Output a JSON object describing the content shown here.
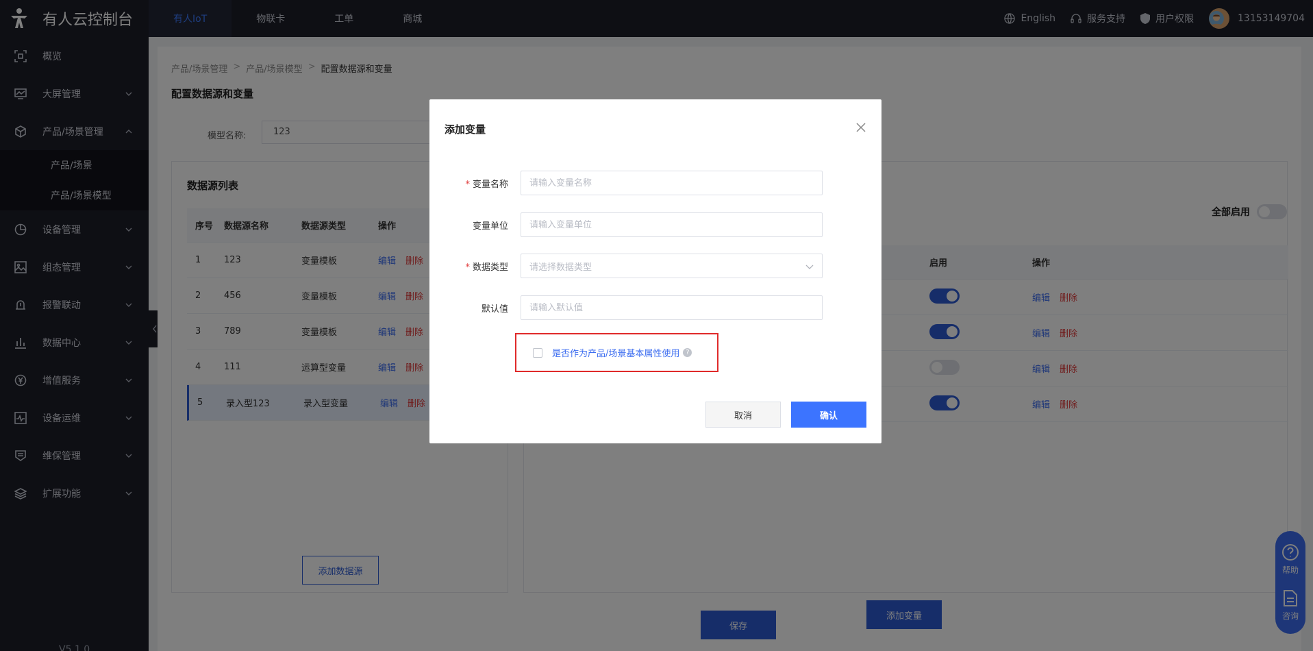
{
  "app": {
    "title": "有人云控制台",
    "version": "V5.1.0"
  },
  "topnav": {
    "tabs": [
      {
        "label": "有人IoT",
        "active": true
      },
      {
        "label": "物联卡",
        "active": false
      },
      {
        "label": "工单",
        "active": false
      },
      {
        "label": "商城",
        "active": false
      }
    ],
    "language": "English",
    "support": "服务支持",
    "permissions": "用户权限",
    "username": "13153149704"
  },
  "sidebar": {
    "items": [
      {
        "label": "概览",
        "icon": "overview-icon"
      },
      {
        "label": "大屏管理",
        "icon": "screen-icon"
      },
      {
        "label": "产品/场景管理",
        "icon": "cube-icon",
        "expanded": true
      },
      {
        "label": "设备管理",
        "icon": "pie-icon"
      },
      {
        "label": "组态管理",
        "icon": "image-icon"
      },
      {
        "label": "报警联动",
        "icon": "alarm-icon"
      },
      {
        "label": "数据中心",
        "icon": "bar-chart-icon"
      },
      {
        "label": "增值服务",
        "icon": "yen-icon"
      },
      {
        "label": "设备运维",
        "icon": "monitor-icon"
      },
      {
        "label": "维保管理",
        "icon": "shield-icon"
      },
      {
        "label": "扩展功能",
        "icon": "layers-icon"
      }
    ],
    "subitems": [
      "产品/场景",
      "产品/场景模型"
    ]
  },
  "main": {
    "breadcrumb": [
      "产品/场景管理",
      "产品/场景模型",
      "配置数据源和变量"
    ],
    "page_title": "配置数据源和变量",
    "model_name_label": "模型名称:",
    "model_name_value": "123",
    "datasource": {
      "title": "数据源列表",
      "headers": [
        "序号",
        "数据源名称",
        "数据源类型",
        "操作"
      ],
      "rows": [
        {
          "no": "1",
          "name": "123",
          "type": "变量模板"
        },
        {
          "no": "2",
          "name": "456",
          "type": "变量模板"
        },
        {
          "no": "3",
          "name": "789",
          "type": "变量模板"
        },
        {
          "no": "4",
          "name": "111",
          "type": "运算型变量"
        },
        {
          "no": "5",
          "name": "录入型123",
          "type": "录入型变量",
          "selected": true
        }
      ],
      "edit_label": "编辑",
      "delete_label": "删除",
      "add_label": "添加数据源"
    },
    "variables": {
      "all_enable_label": "全部启用",
      "headers": [
        "启用",
        "操作"
      ],
      "rows": [
        {
          "enabled": true
        },
        {
          "enabled": true
        },
        {
          "enabled": false
        },
        {
          "enabled": true
        }
      ],
      "edit_label": "编辑",
      "delete_label": "删除",
      "add_label": "添加变量"
    },
    "save_label": "保存"
  },
  "float_help": {
    "help": "帮助",
    "consult": "咨询"
  },
  "modal": {
    "title": "添加变量",
    "fields": {
      "name": {
        "label": "变量名称",
        "placeholder": "请输入变量名称",
        "required": true
      },
      "unit": {
        "label": "变量单位",
        "placeholder": "请输入变量单位",
        "required": false
      },
      "type": {
        "label": "数据类型",
        "placeholder": "请选择数据类型",
        "required": true
      },
      "default": {
        "label": "默认值",
        "placeholder": "请输入默认值",
        "required": false
      }
    },
    "required_mark": "*",
    "checkbox_label": "是否作为产品/场景基本属性使用",
    "help_mark": "?",
    "cancel_label": "取消",
    "confirm_label": "确认"
  },
  "colors": {
    "accent": "#3c74ff",
    "sidebar_bg": "#1c1e29",
    "danger": "#e03a3a",
    "highlight_border": "#e02a2a"
  }
}
